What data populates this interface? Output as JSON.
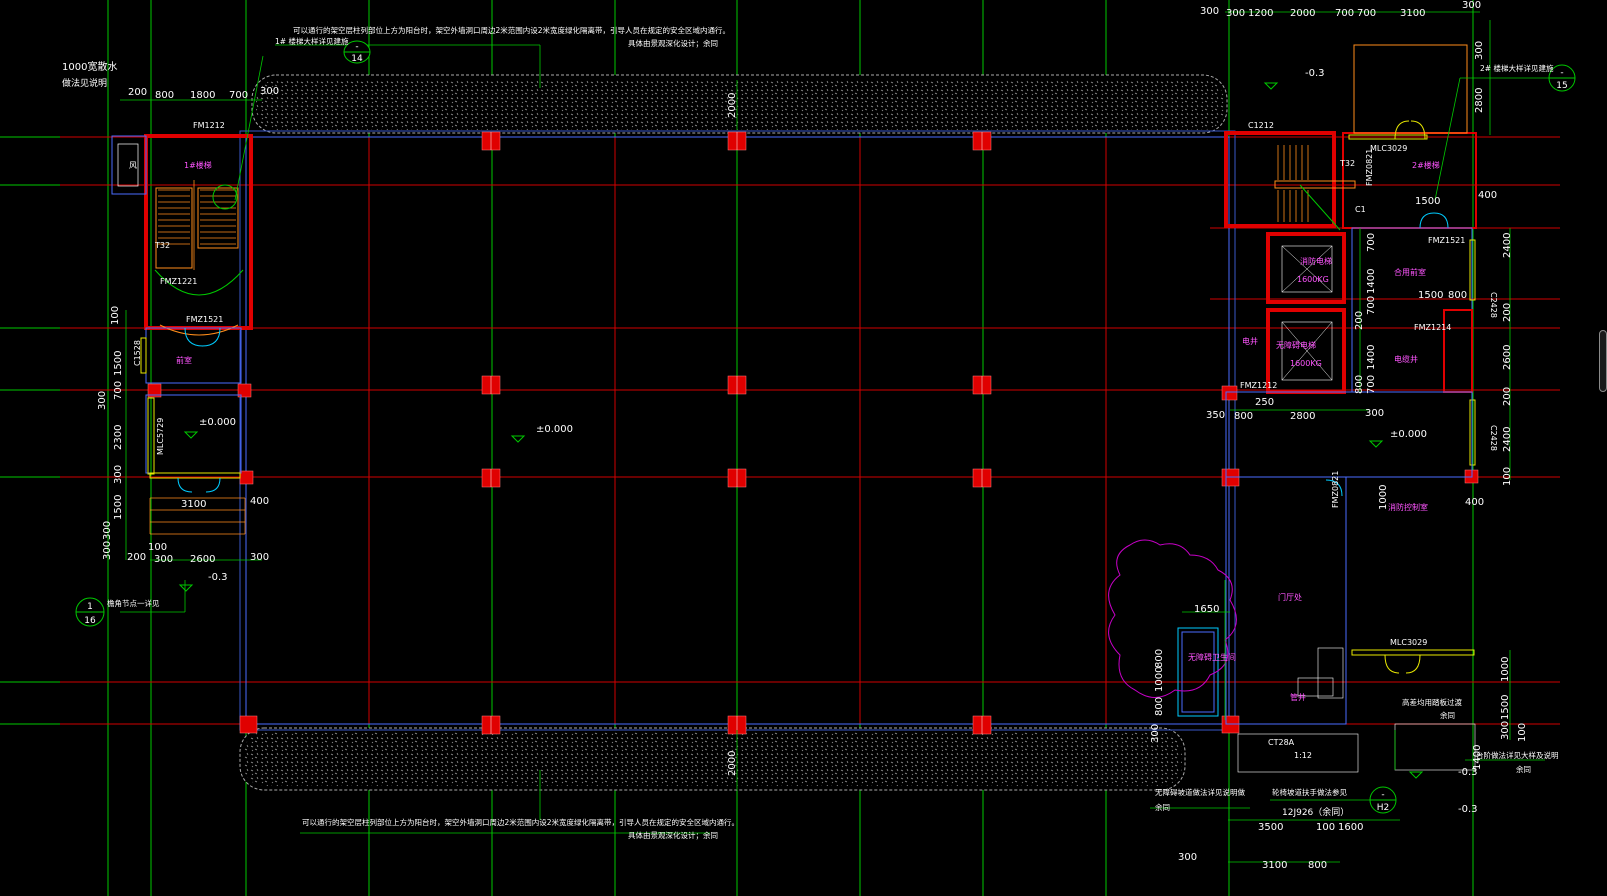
{
  "drawing": {
    "dims_top_right": [
      "300",
      "300",
      "1200",
      "2000",
      "700",
      "700",
      "3100",
      "300"
    ],
    "dims_right_side": [
      "300",
      "2800",
      "400",
      "2400",
      "200",
      "2600",
      "200",
      "2400",
      "100",
      "1000",
      "1500",
      "300",
      "100"
    ],
    "dims_left": [
      "200",
      "800",
      "1800",
      "700",
      "300",
      "100",
      "1500",
      "700",
      "300",
      "2300",
      "300",
      "1500",
      "300",
      "300",
      "200",
      "100",
      "300",
      "2600",
      "300",
      "3100",
      "400"
    ],
    "dims_mid": [
      "2000",
      "2000"
    ],
    "dims_right_stair": [
      "700",
      "1400",
      "700",
      "200",
      "1400",
      "700",
      "1500",
      "800",
      "1500",
      "800",
      "350",
      "800",
      "2800",
      "300",
      "250",
      "1000",
      "400"
    ],
    "dims_bottom_right": [
      "3500",
      "100",
      "1600",
      "3100",
      "800",
      "300",
      "1650",
      "800",
      "1000",
      "800",
      "1400",
      "300"
    ],
    "elevations": [
      "-0.3",
      "-0.3",
      "±0.000",
      "±0.000",
      "±0.000",
      "-0.3",
      "-0.3"
    ],
    "notes": {
      "top_note_1": "可以通行的架空层柱列部位上方为阳台时，架空外墙洞口周边2米范围内设2米宽度绿化隔离带，引导人员在规定的安全区域内通行。",
      "top_note_2": "具体由景观深化设计；余同",
      "bottom_note_1": "可以通行的架空层柱列部位上方为阳台时，架空外墙洞口周边2米范围内设2米宽度绿化隔离带，引导人员在规定的安全区域内通行。",
      "bottom_note_2": "具体由景观深化设计；余同",
      "left_note_1": "1000宽散水",
      "left_note_2": "做法见说明",
      "stair1_ref": "1# 楼梯大样详见建施",
      "stair2_ref": "2# 楼梯大样详见建施",
      "node_note": "檐角节点一详见",
      "ramp_note": "无障碍坡道做法详见说明做",
      "ramp_note2": "余同",
      "access_note": "轮椅坡道扶手做法参见",
      "access_ref": "12J926（余同）",
      "high_note": "高差均用踏板过渡",
      "high_note2": "余同",
      "hole_note": "台阶做法详见大样及说明",
      "hole_note2": "余同"
    },
    "bubbles": {
      "b14_top": "-",
      "b14_bot": "14",
      "b15_top": "-",
      "b15_bot": "15",
      "b16_top": "1",
      "b16_bot": "16",
      "bh2_top": "-",
      "bh2_bot": "H2"
    },
    "rooms": {
      "stair1": "1#楼梯",
      "stair2": "2#楼梯",
      "wind": "风",
      "lobby": "前室",
      "elev1": "消防电梯",
      "elev1_cap": "1600KG",
      "elev2": "无障碍电梯",
      "elev2_cap": "1600KG",
      "well": "电井",
      "hall": "合用前室",
      "elec": "电缆井",
      "fire": "消防控制室",
      "restroom": "无障碍卫生间",
      "shed": "门厅处",
      "duct": "管井"
    },
    "door_tags": {
      "fm1212": "FM1212",
      "fmz1221": "FMZ1221",
      "fmz1521_l": "FMZ1521",
      "c1212": "C1212",
      "mlc3029_t": "MLC3029",
      "fmz1521_r": "FMZ1521",
      "fmz1214": "FMZ1214",
      "fmz0821": "FMZ0821",
      "mlc3029_b": "MLC3029",
      "mlc5729": "MLC5729",
      "c1528": "C1528",
      "c2428a": "C2428",
      "c2428b": "C2428",
      "ct28a": "CT28A",
      "t32": "T32",
      "t32b": "T32",
      "fmz1212": "FMZ1212",
      "fmz0821b": "FMZ0821",
      "cz": "C1"
    },
    "slope": "1:12"
  }
}
